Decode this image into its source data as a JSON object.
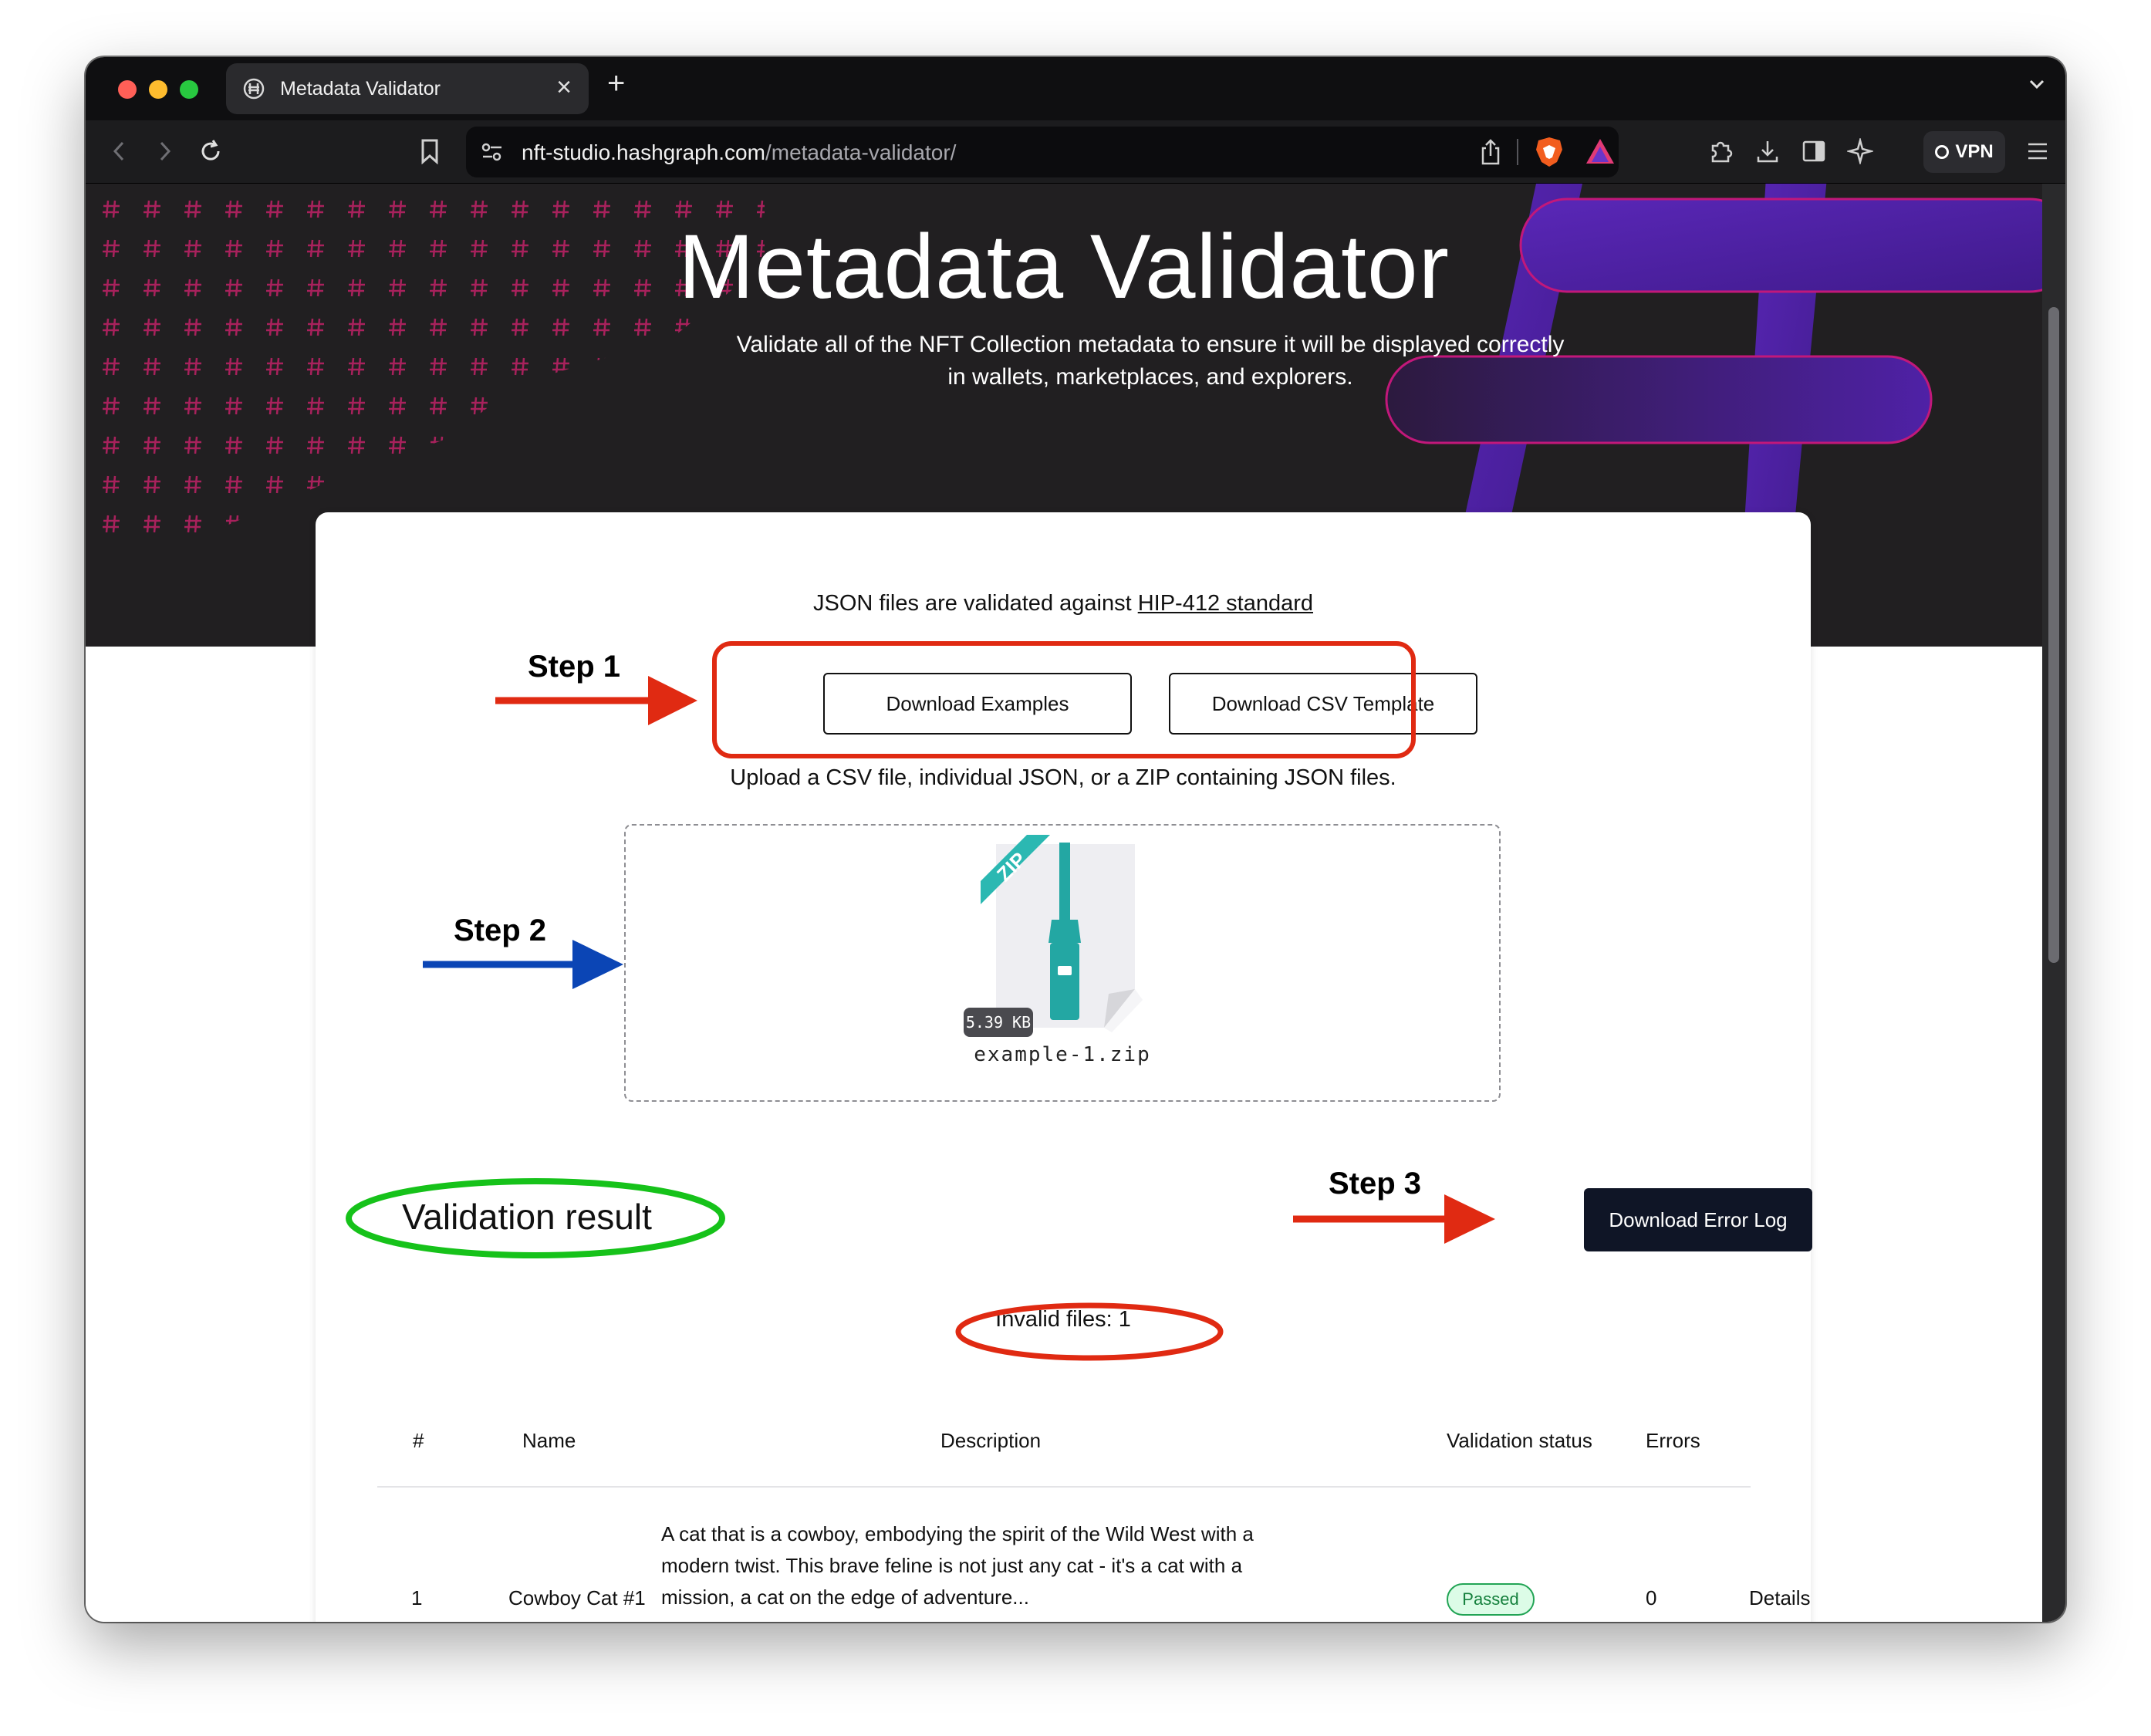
{
  "browser": {
    "tab_title": "Metadata Validator",
    "url_host": "nft-studio.hashgraph.com",
    "url_path": "/metadata-validator/",
    "vpn_label": "VPN"
  },
  "hero": {
    "title": "Metadata Validator",
    "subtitle_line1": "Validate all of the NFT Collection metadata to ensure it will be displayed correctly",
    "subtitle_line2": "in wallets, marketplaces, and explorers."
  },
  "card": {
    "note_prefix": "JSON files are validated against ",
    "note_link": "HIP-412 standard",
    "download_examples": "Download Examples",
    "download_csv": "Download CSV Template",
    "upload_hint": "Upload a CSV file, individual JSON, or a ZIP containing JSON files.",
    "file": {
      "size": "5.39 KB",
      "name": "example-1.zip",
      "icon_label": "ZIP"
    },
    "result_title": "Validation result",
    "download_error_log": "Download Error Log",
    "invalid_files": "Invalid files: 1"
  },
  "table": {
    "headers": [
      "#",
      "Name",
      "Description",
      "Validation status",
      "Errors"
    ],
    "rows": [
      {
        "index": "1",
        "name": "Cowboy Cat #1",
        "description_line1": "A cat that is a cowboy, embodying the spirit of the Wild West with a",
        "description_line2": "modern twist. This brave feline is not just any cat - it's a cat with a",
        "description_line3": "mission, a cat on the edge of adventure...",
        "status": "Passed",
        "errors": "0",
        "details": "Details"
      }
    ]
  },
  "annotations": {
    "step1": "Step 1",
    "step2": "Step 2",
    "step3": "Step 3"
  },
  "colors": {
    "hero_bg": "#211f21",
    "accent_purple": "#4a1d96",
    "annotation_red": "#e02a12",
    "annotation_blue": "#0b45b5",
    "annotation_green": "#16c21a",
    "dark_button": "#0f1526",
    "passed_green": "#22a455"
  }
}
